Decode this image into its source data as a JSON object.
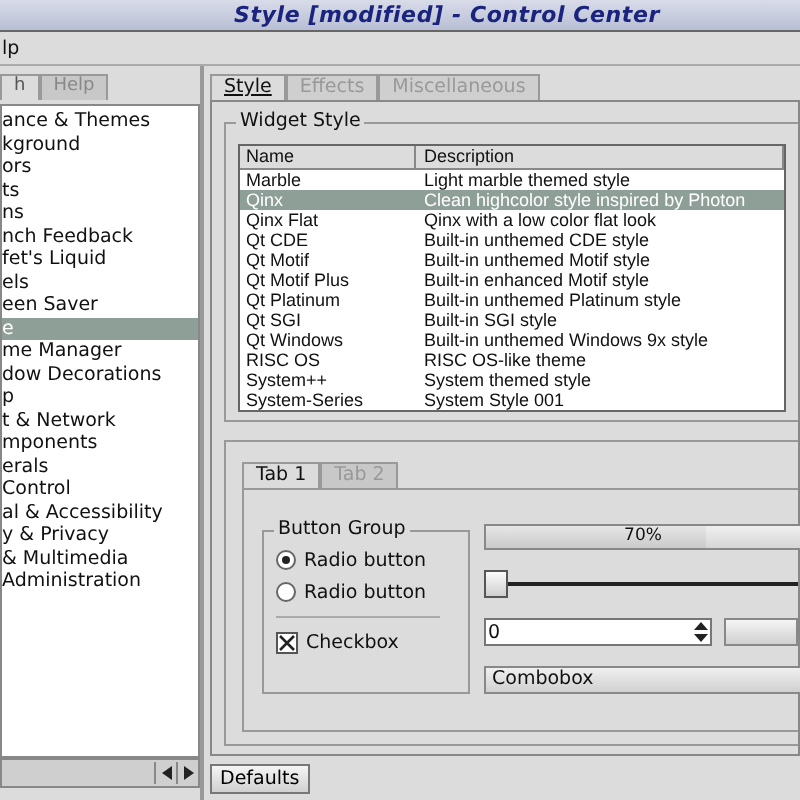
{
  "window": {
    "title": "Style [modified] - Control Center"
  },
  "menu": [
    "lp"
  ],
  "side_tabs": [
    {
      "label": "h",
      "selected": true
    },
    {
      "label": "Help",
      "selected": false
    }
  ],
  "tree": [
    {
      "label": "ance & Themes",
      "selected": false
    },
    {
      "label": "kground",
      "selected": false
    },
    {
      "label": "ors",
      "selected": false
    },
    {
      "label": "ts",
      "selected": false
    },
    {
      "label": "ns",
      "selected": false
    },
    {
      "label": "nch Feedback",
      "selected": false
    },
    {
      "label": "fet's Liquid",
      "selected": false
    },
    {
      "label": "els",
      "selected": false
    },
    {
      "label": "een Saver",
      "selected": false
    },
    {
      "label": "e",
      "selected": true
    },
    {
      "label": "me Manager",
      "selected": false
    },
    {
      "label": "dow Decorations",
      "selected": false
    },
    {
      "label": "p",
      "selected": false
    },
    {
      "label": "t & Network",
      "selected": false
    },
    {
      "label": "mponents",
      "selected": false
    },
    {
      "label": "erals",
      "selected": false
    },
    {
      "label": "Control",
      "selected": false
    },
    {
      "label": "al & Accessibility",
      "selected": false
    },
    {
      "label": "y & Privacy",
      "selected": false
    },
    {
      "label": "& Multimedia",
      "selected": false
    },
    {
      "label": "Administration",
      "selected": false
    }
  ],
  "tabs": [
    {
      "label": "Style",
      "selected": true
    },
    {
      "label": "Effects",
      "selected": false
    },
    {
      "label": "Miscellaneous",
      "selected": false
    }
  ],
  "widget_style": {
    "title": "Widget Style",
    "columns": [
      "Name",
      "Description"
    ],
    "rows": [
      {
        "name": "Marble",
        "description": "Light marble themed style",
        "selected": false
      },
      {
        "name": "Qinx",
        "description": "Clean highcolor style inspired by Photon",
        "selected": true
      },
      {
        "name": "Qinx Flat",
        "description": "Qinx with a low color flat look",
        "selected": false
      },
      {
        "name": "Qt CDE",
        "description": "Built-in unthemed CDE style",
        "selected": false
      },
      {
        "name": "Qt Motif",
        "description": "Built-in unthemed Motif style",
        "selected": false
      },
      {
        "name": "Qt Motif Plus",
        "description": "Built-in enhanced Motif style",
        "selected": false
      },
      {
        "name": "Qt Platinum",
        "description": "Built-in unthemed Platinum style",
        "selected": false
      },
      {
        "name": "Qt SGI",
        "description": "Built-in SGI style",
        "selected": false
      },
      {
        "name": "Qt Windows",
        "description": "Built-in unthemed Windows 9x style",
        "selected": false
      },
      {
        "name": "RISC OS",
        "description": "RISC OS-like theme",
        "selected": false
      },
      {
        "name": "System++",
        "description": "System themed style",
        "selected": false
      },
      {
        "name": "System-Series",
        "description": "System Style 001",
        "selected": false
      }
    ]
  },
  "preview": {
    "tabs": [
      {
        "label": "Tab 1",
        "selected": true
      },
      {
        "label": "Tab 2",
        "selected": false
      }
    ],
    "group_title": "Button Group",
    "radios": [
      {
        "label": "Radio button",
        "selected": true
      },
      {
        "label": "Radio button",
        "selected": false
      }
    ],
    "checkbox": {
      "label": "Checkbox",
      "checked": true
    },
    "progress_text": "70%",
    "progress": {
      "level": 0.7
    },
    "slider": {
      "level": 0
    },
    "spin_value": "0",
    "combobox": "Combobox"
  },
  "buttons": [
    "Defaults"
  ]
}
